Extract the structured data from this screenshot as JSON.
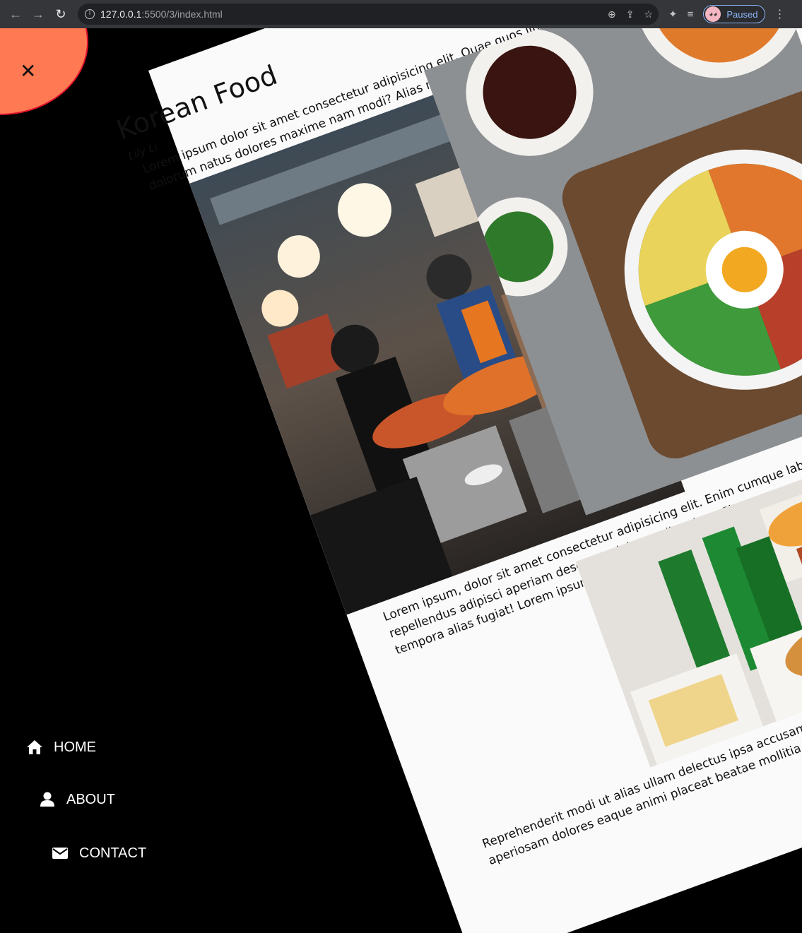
{
  "browser": {
    "url_host": "127.0.0.1",
    "url_rest": ":5500/3/index.html",
    "profile_status": "Paused"
  },
  "article": {
    "title": "Korean Food",
    "author": "Lily Li",
    "paragraph1": [
      "Lorem ipsum dolor sit amet consectetur adipisicing elit. Quae quos libero inventore q",
      "dolorum natus dolores maxime nam modi? Alias nemo libero inventore"
    ],
    "paragraph2": [
      "Lorem ipsum, dolor sit amet consectetur adipisicing elit. Enim cumque labore fugit molestias",
      "repellendus adipisci aperiam deserunt, dolore quibusdam. Sit, earum quod soluta mpiditate",
      "tempora alias fugiat! Lorem ipsum dolor, sit amet consectetur adipisicing elit."
    ],
    "paragraph3": [
      "Reprehenderit modi ut alias ullam delectus ipsa accusamus itaque soluta su",
      "aperiosam dolores eaque animi placeat beatae mollitia magni."
    ]
  },
  "menu": {
    "close_symbol": "✕",
    "items": [
      {
        "label": "HOME",
        "icon": "home-icon"
      },
      {
        "label": "ABOUT",
        "icon": "user-icon"
      },
      {
        "label": "CONTACT",
        "icon": "envelope-icon"
      }
    ]
  },
  "colors": {
    "close_bg": "#ff7a52",
    "close_border": "#e0112b",
    "card_bg": "#fafafa",
    "page_bg": "#000000"
  }
}
